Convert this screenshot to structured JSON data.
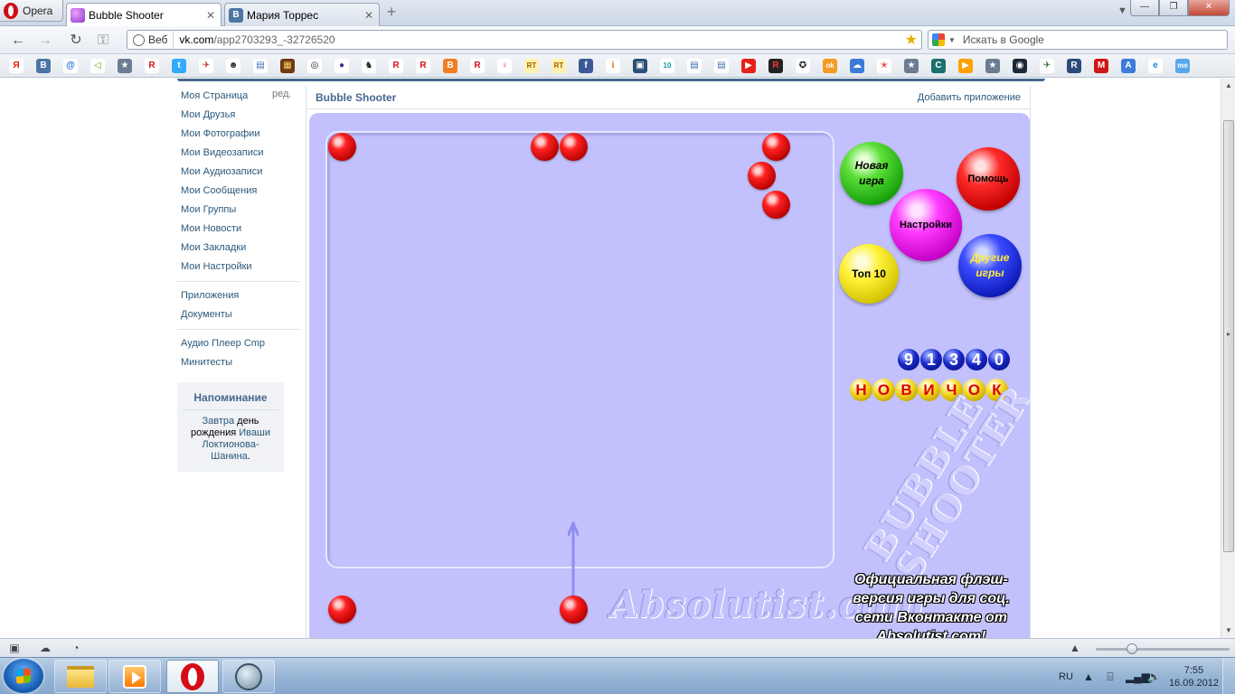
{
  "browser": {
    "menu_label": "Opera",
    "tabs": [
      {
        "title": "Bubble Shooter",
        "active": true
      },
      {
        "title": "Мария Торрес",
        "active": false
      }
    ],
    "address": {
      "badge": "Веб",
      "url_host": "vk.com",
      "url_path": "/app2703293_-32726520"
    },
    "search": {
      "placeholder": "Искать в Google"
    },
    "bookmarks": [
      {
        "icon": "yandex-icon",
        "glyph": "Я",
        "color": "#ffffff",
        "fg": "#e61400"
      },
      {
        "icon": "vk-icon",
        "glyph": "В",
        "color": "#4c75a3",
        "fg": "#ffffff"
      },
      {
        "icon": "mail-at-icon",
        "glyph": "@",
        "color": "#ffffff",
        "fg": "#1e6fd9"
      },
      {
        "icon": "sidebar-icon",
        "glyph": "◁",
        "color": "#ffffff",
        "fg": "#5fa800"
      },
      {
        "icon": "star-bookmark-icon",
        "glyph": "★",
        "color": "#6b7c93",
        "fg": "#ffffff"
      },
      {
        "icon": "r-icon",
        "glyph": "R",
        "color": "#ffffff",
        "fg": "#d11515"
      },
      {
        "icon": "twitter-icon",
        "glyph": "t",
        "color": "#33aaff",
        "fg": "#ffffff"
      },
      {
        "icon": "bird-icon",
        "glyph": "✈",
        "color": "#ffffff",
        "fg": "#c62b2b"
      },
      {
        "icon": "people-icon",
        "glyph": "☻",
        "color": "#ffffff",
        "fg": "#333333"
      },
      {
        "icon": "page-icon",
        "glyph": "▤",
        "color": "#ffffff",
        "fg": "#3b6fb0"
      },
      {
        "icon": "cube-icon",
        "glyph": "▦",
        "color": "#6b3b12",
        "fg": "#ffcc66"
      },
      {
        "icon": "spiral-icon",
        "glyph": "◎",
        "color": "#ffffff",
        "fg": "#222222"
      },
      {
        "icon": "ball-icon",
        "glyph": "●",
        "color": "#ffffff",
        "fg": "#4b2b8a"
      },
      {
        "icon": "horse-icon",
        "glyph": "♞",
        "color": "#ffffff",
        "fg": "#222222"
      },
      {
        "icon": "r-icon",
        "glyph": "R",
        "color": "#ffffff",
        "fg": "#d11515"
      },
      {
        "icon": "r-icon",
        "glyph": "R",
        "color": "#ffffff",
        "fg": "#d11515"
      },
      {
        "icon": "blogger-icon",
        "glyph": "B",
        "color": "#f37c1f",
        "fg": "#ffffff"
      },
      {
        "icon": "r-icon",
        "glyph": "R",
        "color": "#ffffff",
        "fg": "#d11515"
      },
      {
        "icon": "figure-icon",
        "glyph": "♀",
        "color": "#ffffff",
        "fg": "#e0308a"
      },
      {
        "icon": "rt-icon",
        "glyph": "RT",
        "color": "#fff2b0",
        "fg": "#a05a00"
      },
      {
        "icon": "rt-icon",
        "glyph": "RT",
        "color": "#fff2b0",
        "fg": "#a05a00"
      },
      {
        "icon": "facebook-icon",
        "glyph": "f",
        "color": "#3b5998",
        "fg": "#ffffff"
      },
      {
        "icon": "info-icon",
        "glyph": "i",
        "color": "#ffffff",
        "fg": "#e66000"
      },
      {
        "icon": "contact-icon",
        "glyph": "▣",
        "color": "#2e4f74",
        "fg": "#ffffff"
      },
      {
        "icon": "tv-icon",
        "glyph": "10",
        "color": "#ffffff",
        "fg": "#0aa0a0"
      },
      {
        "icon": "page-icon",
        "glyph": "▤",
        "color": "#ffffff",
        "fg": "#3b6fb0"
      },
      {
        "icon": "page-icon",
        "glyph": "▤",
        "color": "#ffffff",
        "fg": "#3b6fb0"
      },
      {
        "icon": "youtube-icon",
        "glyph": "▶",
        "color": "#e62117",
        "fg": "#ffffff"
      },
      {
        "icon": "r-black-icon",
        "glyph": "R",
        "color": "#222222",
        "fg": "#ff3030"
      },
      {
        "icon": "star-black-icon",
        "glyph": "✪",
        "color": "#ffffff",
        "fg": "#111111"
      },
      {
        "icon": "odnoklassniki-icon",
        "glyph": "ok",
        "color": "#f59a23",
        "fg": "#ffffff"
      },
      {
        "icon": "cloud-icon",
        "glyph": "☁",
        "color": "#3d7bd9",
        "fg": "#ffffff"
      },
      {
        "icon": "red-star-icon",
        "glyph": "✭",
        "color": "#ffffff",
        "fg": "#e01b1b"
      },
      {
        "icon": "star-bookmark-icon",
        "glyph": "★",
        "color": "#6b7c93",
        "fg": "#ffffff"
      },
      {
        "icon": "c-icon",
        "glyph": "C",
        "color": "#1d6f6f",
        "fg": "#ffffff"
      },
      {
        "icon": "play-icon",
        "glyph": "▶",
        "color": "#ffa000",
        "fg": "#ffffff"
      },
      {
        "icon": "star-bookmark-icon",
        "glyph": "★",
        "color": "#6b7c93",
        "fg": "#ffffff"
      },
      {
        "icon": "steam-icon",
        "glyph": "◉",
        "color": "#1b2838",
        "fg": "#ffffff"
      },
      {
        "icon": "plane-icon",
        "glyph": "✈",
        "color": "#ffffff",
        "fg": "#2a6a2a"
      },
      {
        "icon": "r-box-icon",
        "glyph": "R",
        "color": "#2c4b7c",
        "fg": "#ffffff"
      },
      {
        "icon": "mask-icon",
        "glyph": "M",
        "color": "#d11515",
        "fg": "#ffffff"
      },
      {
        "icon": "translate-icon",
        "glyph": "A",
        "color": "#3d7bd9",
        "fg": "#ffffff"
      },
      {
        "icon": "ie-icon",
        "glyph": "e",
        "color": "#ffffff",
        "fg": "#1e88d6"
      },
      {
        "icon": "me-icon",
        "glyph": "me",
        "color": "#59a7e8",
        "fg": "#ffffff"
      }
    ]
  },
  "sidebar": {
    "edit_label": "ред.",
    "group1": [
      "Моя Страница",
      "Мои Друзья",
      "Мои Фотографии",
      "Мои Видеозаписи",
      "Мои Аудиозаписи",
      "Мои Сообщения",
      "Мои Группы",
      "Мои Новости",
      "Мои Закладки",
      "Мои Настройки"
    ],
    "group2": [
      "Приложения",
      "Документы"
    ],
    "group3": [
      "Аудио Плеер Cmp",
      "Минитесты"
    ]
  },
  "reminder": {
    "title": "Напоминание",
    "when": "Завтра",
    "text1": " день рождения ",
    "name": "Иваши Локтионова-Шанина",
    "end": "."
  },
  "app": {
    "title": "Bubble Shooter",
    "add_label": "Добавить приложение"
  },
  "game": {
    "colors": {
      "field_bg": "#c2c1fd",
      "ball_red": "#ff2020"
    },
    "menu": {
      "new_game_line1": "Новая",
      "new_game_line2": "игра",
      "help": "Помощь",
      "settings": "Настройки",
      "top10": "Топ 10",
      "other_line1": "Другие",
      "other_line2": "игры"
    },
    "score_digits": [
      "9",
      "1",
      "3",
      "4",
      "0"
    ],
    "rank_letters": [
      "Н",
      "О",
      "В",
      "И",
      "Ч",
      "О",
      "К"
    ],
    "logo_line1": "BUBBLE",
    "logo_line2": "SHOOTER",
    "watermark": "Absolutist.com",
    "promo": "Официальная флэш-версия игры для соц. сети Вконтакте от Absolutist.com!"
  },
  "taskbar": {
    "language": "RU",
    "time": "7:55",
    "date": "16.09.2012"
  }
}
